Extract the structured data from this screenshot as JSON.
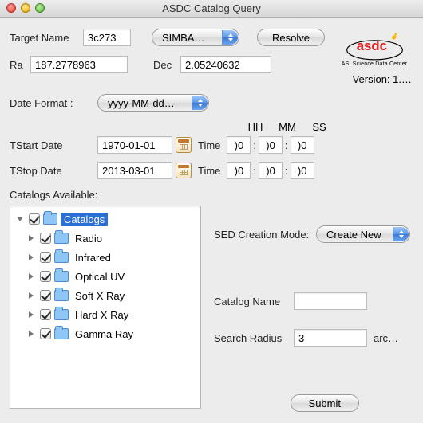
{
  "window": {
    "title": "ASDC Catalog Query"
  },
  "logo": {
    "text": "asdc",
    "sub": "ASI Science Data Center"
  },
  "version_label": "Version: 1.…",
  "labels": {
    "target": "Target Name",
    "resolve": "Resolve",
    "simbad": "SIMBA…",
    "ra": "Ra",
    "dec": "Dec",
    "date_format": "Date Format  :",
    "date_format_val": "yyyy-MM-dd…",
    "tstart": "TStart Date",
    "tstop": "TStop Date",
    "time": "Time",
    "hh": "HH",
    "mm": "MM",
    "ss": "SS",
    "catalogs_avail": "Catalogs Available:",
    "sed_mode": "SED Creation Mode:",
    "sed_val": "Create New",
    "cat_name": "Catalog Name",
    "search_radius": "Search Radius",
    "radius_unit": "arc…",
    "submit": "Submit"
  },
  "values": {
    "target": "3c273",
    "ra": "187.2778963",
    "dec": "2.05240632",
    "tstart": "1970-01-01",
    "tstop": "2013-03-01",
    "hh1": ")0",
    "mm1": ")0",
    "ss1": ")0",
    "hh2": ")0",
    "mm2": ")0",
    "ss2": ")0",
    "cat_name": "",
    "radius": "3"
  },
  "tree": {
    "root": "Catalogs",
    "items": [
      "Radio",
      "Infrared",
      "Optical UV",
      "Soft X Ray",
      "Hard X Ray",
      "Gamma Ray"
    ]
  }
}
